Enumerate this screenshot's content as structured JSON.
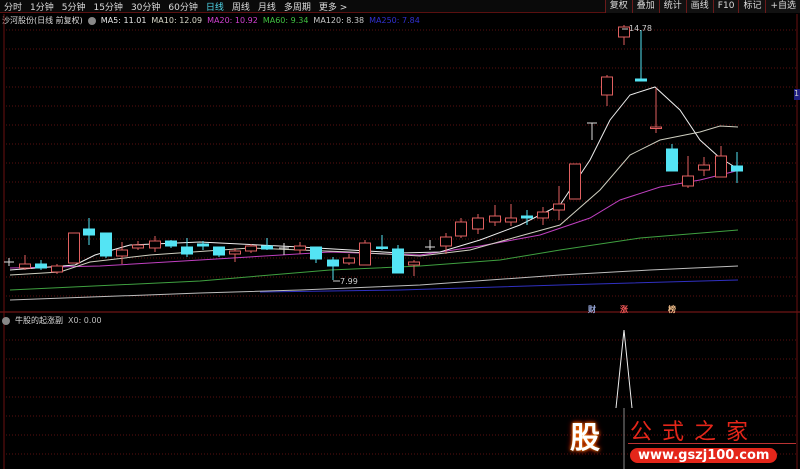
{
  "periods": [
    "分时",
    "1分钟",
    "5分钟",
    "15分钟",
    "30分钟",
    "60分钟",
    "日线",
    "周线",
    "月线",
    "多周期",
    "更多 >"
  ],
  "active_period": "日线",
  "right_buttons": [
    "复权",
    "叠加",
    "统计",
    "画线",
    "F10",
    "标记",
    "+自选"
  ],
  "main": {
    "stock": "沙河股份(日线 前复权)",
    "ma": [
      {
        "label": "MA5: 11.01",
        "color": "#e8e8e8"
      },
      {
        "label": "MA10: 12.09",
        "color": "#d8d8c8"
      },
      {
        "label": "MA20: 10.92",
        "color": "#d040d0"
      },
      {
        "label": "MA60: 9.34",
        "color": "#40c040"
      },
      {
        "label": "MA120: 8.38",
        "color": "#c8c8c8"
      },
      {
        "label": "MA250: 7.84",
        "color": "#3030d0"
      }
    ],
    "high_label": "14.78",
    "low_label": "7.99",
    "event_tags": [
      {
        "text": "财",
        "color": "#9ad"
      },
      {
        "text": "涨",
        "color": "#e55"
      },
      {
        "text": "榜",
        "color": "#eb8"
      }
    ],
    "axis_tag": "1"
  },
  "sub": {
    "name": "牛股的起涨副",
    "value": "X0: 0.00"
  },
  "colors": {
    "up": "#e06060",
    "down": "#54e4f4",
    "grid": "#5a1010"
  },
  "logo": {
    "glyph": "股",
    "name": "公式之家",
    "url": "www.gszj100.com"
  }
}
